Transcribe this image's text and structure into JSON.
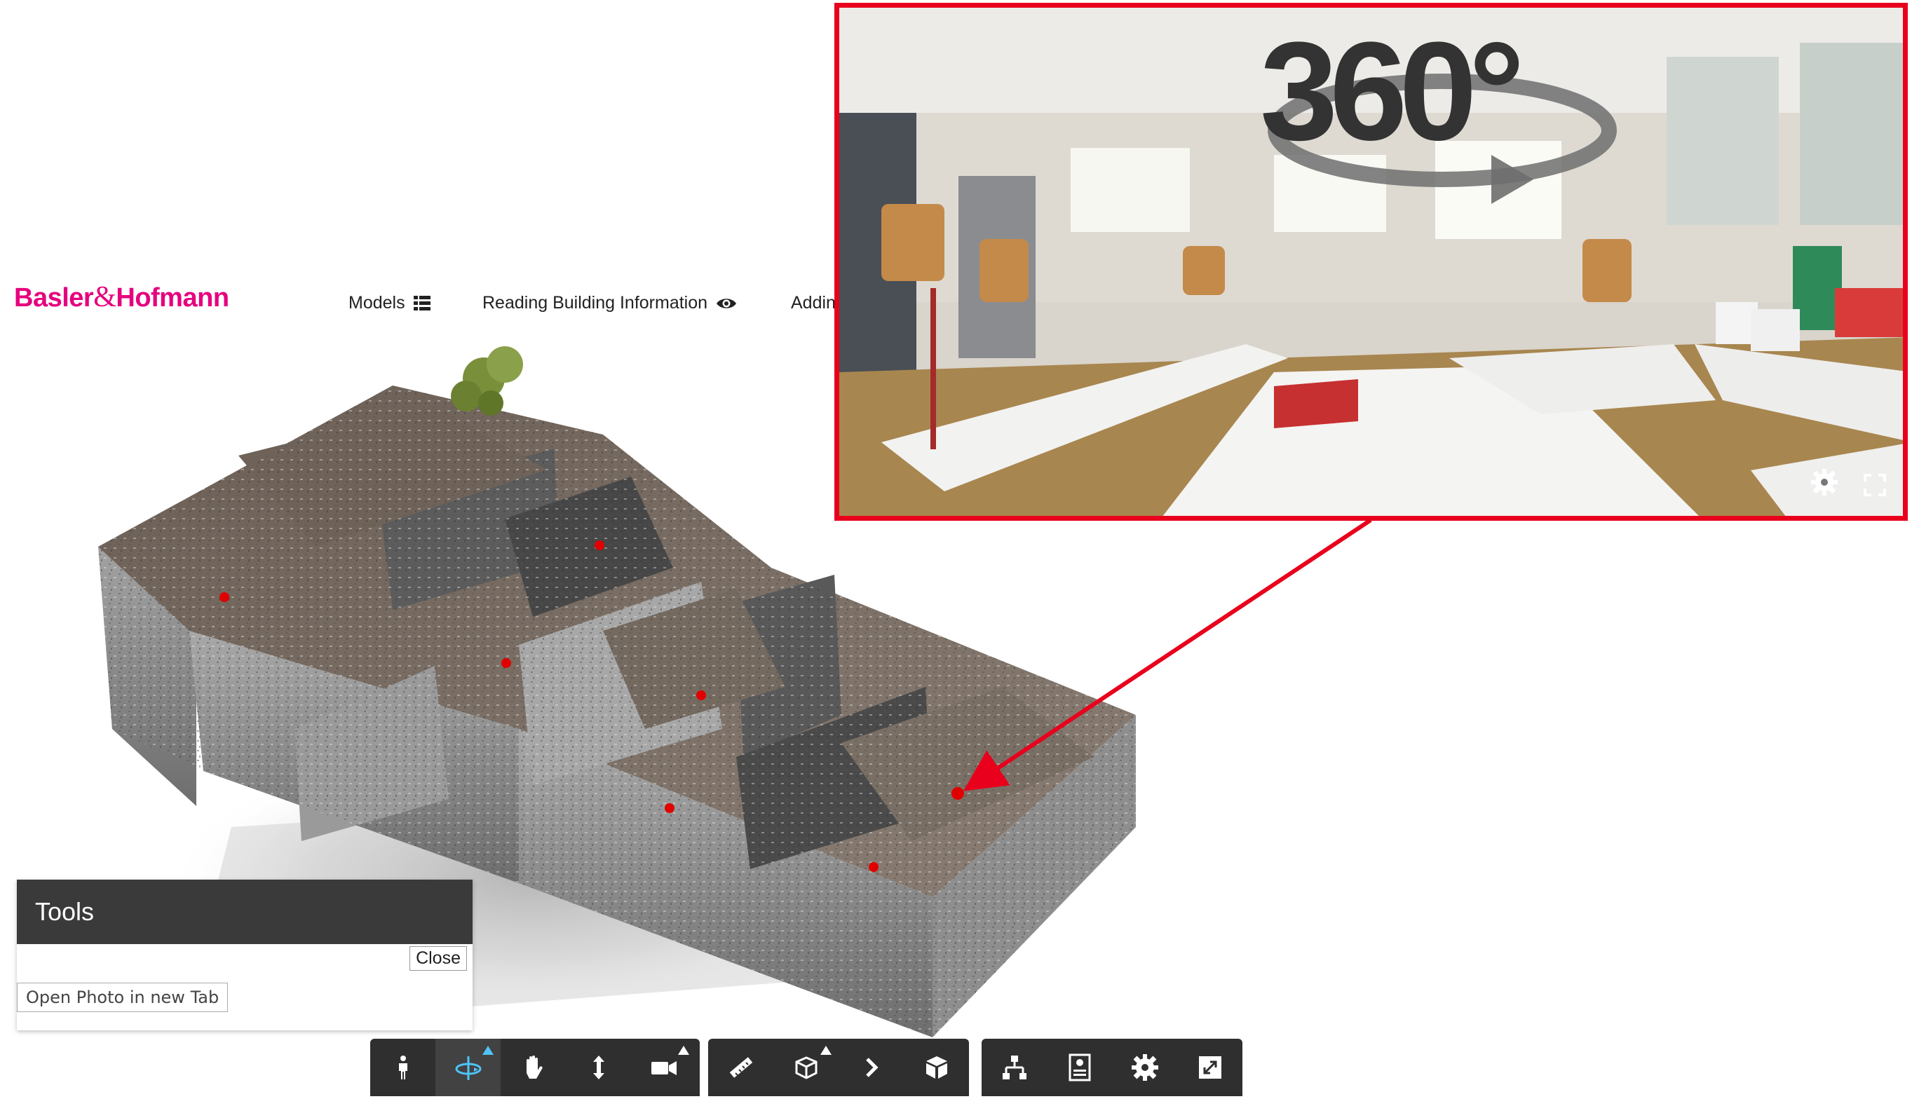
{
  "header": {
    "logo_part1": "Basler",
    "logo_amp": "&",
    "logo_part2": "Hofmann",
    "nav": {
      "models_label": "Models",
      "reading_label": "Reading Building Information",
      "adding_label": "Addin"
    }
  },
  "panorama": {
    "title": "360°",
    "settings_icon": "gear-icon",
    "fullscreen_icon": "fullscreen-icon"
  },
  "tools_panel": {
    "title": "Tools",
    "close_label": "Close",
    "open_photo_label": "Open Photo in new Tab"
  },
  "toolbar": {
    "groups": [
      [
        "walk-icon",
        "orbit-icon",
        "pan-hand-icon",
        "dolly-icon",
        "camera-icon"
      ],
      [
        "measure-icon",
        "section-box-icon",
        "explode-chevron-icon",
        "cube-icon"
      ],
      [
        "model-browser-icon",
        "properties-icon",
        "settings-gear-icon",
        "fullscreen-icon"
      ]
    ],
    "active": "orbit-icon"
  },
  "colors": {
    "brand": "#e6007e",
    "highlight_border": "#e8001c",
    "toolbar_bg": "#2f2f2f",
    "active_tool": "#4fc3f7",
    "photo_marker": "#e00000"
  }
}
